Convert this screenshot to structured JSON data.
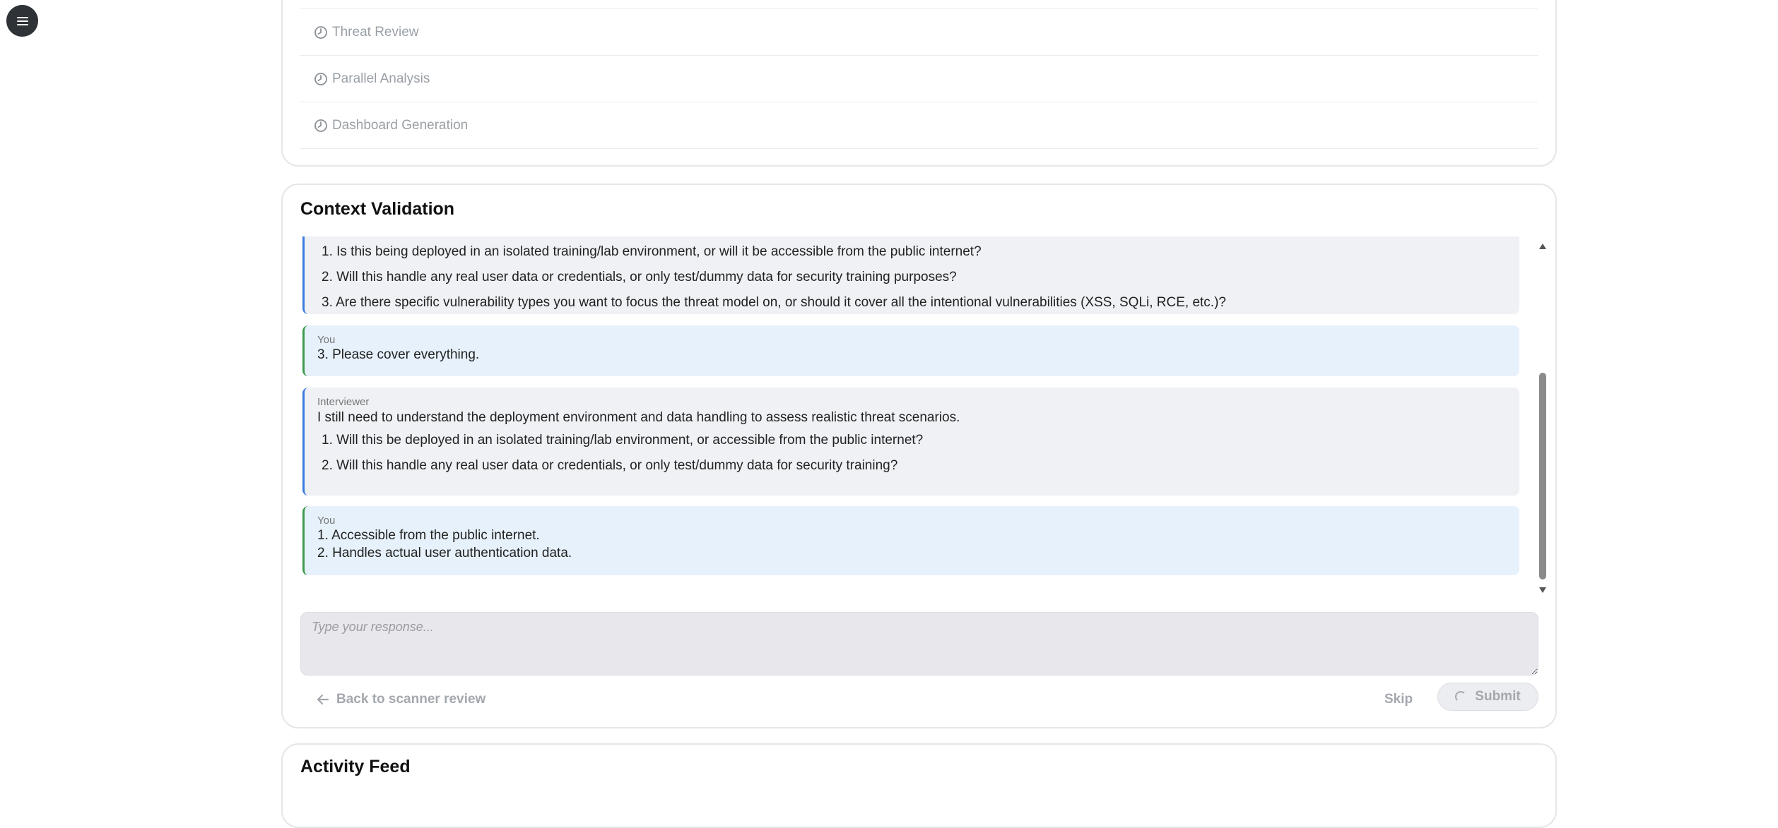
{
  "menu": {
    "icon": "hamburger-menu-icon"
  },
  "pipeline": {
    "steps": [
      {
        "label": "Threat Review",
        "icon": "clock-icon"
      },
      {
        "label": "Parallel Analysis",
        "icon": "clock-icon"
      },
      {
        "label": "Dashboard Generation",
        "icon": "clock-icon"
      }
    ]
  },
  "context_validation": {
    "title": "Context Validation",
    "messages": [
      {
        "role": "interviewer",
        "items": [
          "1. Is this being deployed in an isolated training/lab environment, or will it be accessible from the public internet?",
          "2. Will this handle any real user data or credentials, or only test/dummy data for security training purposes?",
          "3. Are there specific vulnerability types you want to focus the threat model on, or should it cover all the intentional vulnerabilities (XSS, SQLi, RCE, etc.)?"
        ]
      },
      {
        "role": "user",
        "sender": "You",
        "lines": [
          "3. Please cover everything."
        ]
      },
      {
        "role": "interviewer",
        "sender": "Interviewer",
        "intro": "I still need to understand the deployment environment and data handling to assess realistic threat scenarios.",
        "items": [
          "1. Will this be deployed in an isolated training/lab environment, or accessible from the public internet?",
          "2. Will this handle any real user data or credentials, or only test/dummy data for security training?"
        ]
      },
      {
        "role": "user",
        "sender": "You",
        "lines": [
          "1. Accessible from the public internet.",
          "2. Handles actual user authentication data."
        ]
      }
    ],
    "input_placeholder": "Type your response...",
    "back_label": "Back to scanner review",
    "skip_label": "Skip",
    "submit_label": "Submit"
  },
  "activity_feed": {
    "title": "Activity Feed"
  },
  "colors": {
    "interviewer_border": "#3b7ddd",
    "user_border": "#3e9a4e",
    "interviewer_bg": "#eff1f5",
    "user_bg": "#e6f1fb"
  }
}
